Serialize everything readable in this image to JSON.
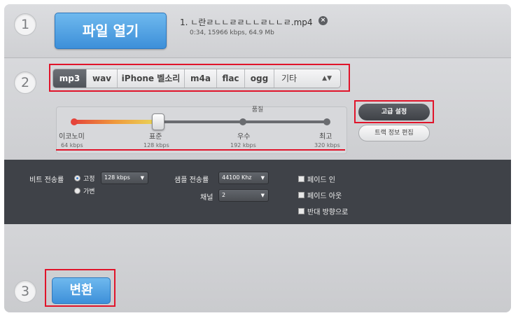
{
  "steps": {
    "one": "1",
    "two": "2",
    "three": "3"
  },
  "file": {
    "open_label": "파일 열기",
    "name": "1. ㄴ란ㄹㄴㄴㄹㄹㄴㄴㄹㄴㄴㄹ.mp4",
    "meta": "0:34, 15966 kbps, 64.9 Mb",
    "remove_icon": "close-circle-icon"
  },
  "formats": {
    "tabs": [
      {
        "label": "mp3",
        "active": true
      },
      {
        "label": "wav",
        "active": false
      },
      {
        "label": "iPhone 벨소리",
        "active": false
      },
      {
        "label": "m4a",
        "active": false
      },
      {
        "label": "flac",
        "active": false
      },
      {
        "label": "ogg",
        "active": false
      }
    ],
    "other": "기타"
  },
  "quality": {
    "label": "품질",
    "selected_index": 1,
    "levels": [
      {
        "name": "이코노미",
        "rate": "64 kbps"
      },
      {
        "name": "표준",
        "rate": "128 kbps"
      },
      {
        "name": "우수",
        "rate": "192 kbps"
      },
      {
        "name": "최고",
        "rate": "320 kbps"
      }
    ]
  },
  "buttons": {
    "advanced": "고급 설정",
    "tags": "트랙 정보 편집",
    "convert": "변환"
  },
  "advanced": {
    "bitrate_label": "비트 전송률",
    "mode_fixed": "고정",
    "mode_variable": "가변",
    "bitrate_value": "128 kbps",
    "samplerate_label": "샘플 전송률",
    "samplerate_value": "44100 Khz",
    "channels_label": "채널",
    "channels_value": "2",
    "fade_in": "페이드 인",
    "fade_out": "페이드 아웃",
    "reverse": "반대 방향으로"
  },
  "colors": {
    "accent_blue": "#3d8fd9",
    "highlight_red": "#e0142a",
    "panel_dark": "#3f4248"
  }
}
